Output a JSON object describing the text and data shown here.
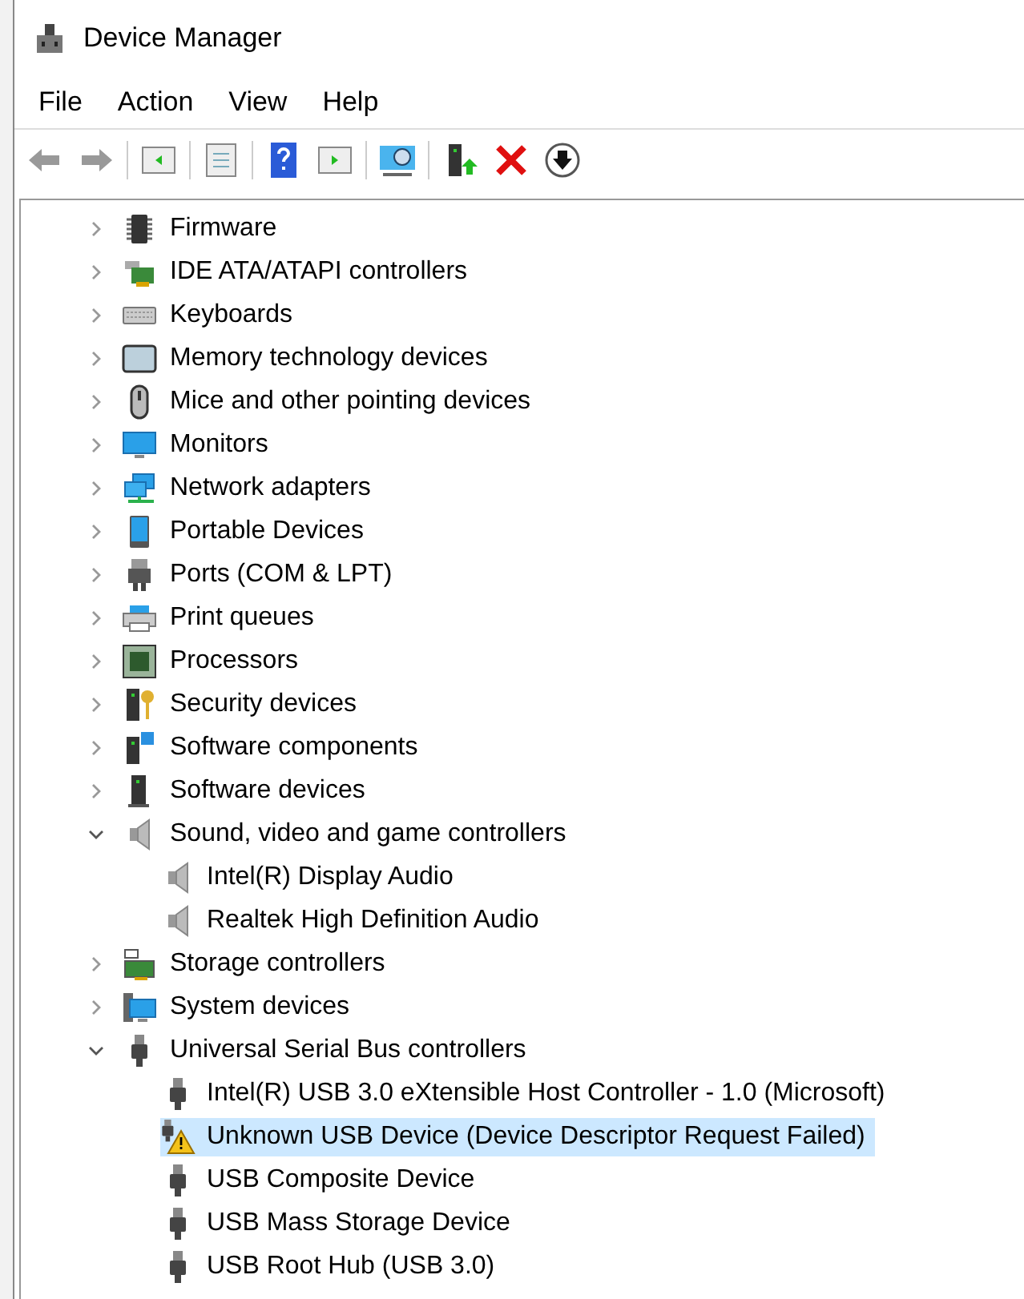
{
  "window": {
    "title": "Device Manager"
  },
  "menu": [
    "File",
    "Action",
    "View",
    "Help"
  ],
  "tree": [
    {
      "label": "Firmware",
      "kind": "chip",
      "expanded": false
    },
    {
      "label": "IDE ATA/ATAPI controllers",
      "kind": "card",
      "expanded": false
    },
    {
      "label": "Keyboards",
      "kind": "keyboard",
      "expanded": false
    },
    {
      "label": "Memory technology devices",
      "kind": "memory",
      "expanded": false
    },
    {
      "label": "Mice and other pointing devices",
      "kind": "mouse",
      "expanded": false
    },
    {
      "label": "Monitors",
      "kind": "monitor",
      "expanded": false
    },
    {
      "label": "Network adapters",
      "kind": "network",
      "expanded": false
    },
    {
      "label": "Portable Devices",
      "kind": "tablet",
      "expanded": false
    },
    {
      "label": "Ports (COM & LPT)",
      "kind": "port",
      "expanded": false
    },
    {
      "label": "Print queues",
      "kind": "printer",
      "expanded": false
    },
    {
      "label": "Processors",
      "kind": "processor",
      "expanded": false
    },
    {
      "label": "Security devices",
      "kind": "tower-key",
      "expanded": false
    },
    {
      "label": "Software components",
      "kind": "tower-puzzle",
      "expanded": false
    },
    {
      "label": "Software devices",
      "kind": "tower",
      "expanded": false
    },
    {
      "label": "Sound, video and game controllers",
      "kind": "speaker",
      "expanded": true,
      "children": [
        {
          "label": "Intel(R) Display Audio",
          "kind": "speaker",
          "warning": false,
          "selected": false
        },
        {
          "label": "Realtek High Definition Audio",
          "kind": "speaker",
          "warning": false,
          "selected": false
        }
      ]
    },
    {
      "label": "Storage controllers",
      "kind": "storage",
      "expanded": false
    },
    {
      "label": "System devices",
      "kind": "system",
      "expanded": false
    },
    {
      "label": "Universal Serial Bus controllers",
      "kind": "usb",
      "expanded": true,
      "children": [
        {
          "label": "Intel(R) USB 3.0 eXtensible Host Controller - 1.0 (Microsoft)",
          "kind": "usb",
          "warning": false,
          "selected": false
        },
        {
          "label": "Unknown USB Device (Device Descriptor Request Failed)",
          "kind": "usb",
          "warning": true,
          "selected": true
        },
        {
          "label": "USB Composite Device",
          "kind": "usb",
          "warning": false,
          "selected": false
        },
        {
          "label": "USB Mass Storage Device",
          "kind": "usb",
          "warning": false,
          "selected": false
        },
        {
          "label": "USB Root Hub (USB 3.0)",
          "kind": "usb",
          "warning": false,
          "selected": false
        }
      ]
    }
  ]
}
